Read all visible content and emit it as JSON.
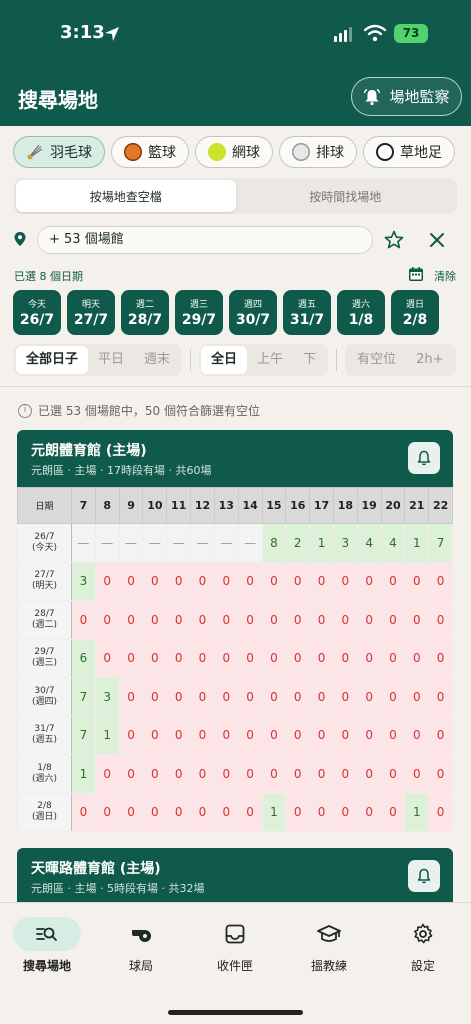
{
  "status": {
    "time": "3:13",
    "battery": "73"
  },
  "header": {
    "title": "搜尋場地",
    "monitor_label": "場地監察"
  },
  "sports": [
    {
      "label": "羽毛球",
      "icon": "shuttlecock-icon",
      "active": true
    },
    {
      "label": "籃球",
      "icon": "basketball-icon",
      "active": false
    },
    {
      "label": "網球",
      "icon": "tennis-ball-icon",
      "active": false
    },
    {
      "label": "排球",
      "icon": "volleyball-icon",
      "active": false
    },
    {
      "label": "草地足",
      "icon": "soccer-ball-icon",
      "active": false
    }
  ],
  "mode_tabs": [
    {
      "label": "按場地查空檔",
      "active": true
    },
    {
      "label": "按時間找場地",
      "active": false
    }
  ],
  "venue_filter": {
    "label": "+ 53 個場館"
  },
  "dates_section": {
    "selected_label": "已選 8 個日期",
    "clear_label": "清除"
  },
  "dates": [
    {
      "weekday": "今天",
      "date": "26/7"
    },
    {
      "weekday": "明天",
      "date": "27/7"
    },
    {
      "weekday": "週二",
      "date": "28/7"
    },
    {
      "weekday": "週三",
      "date": "29/7"
    },
    {
      "weekday": "週四",
      "date": "30/7"
    },
    {
      "weekday": "週五",
      "date": "31/7"
    },
    {
      "weekday": "週六",
      "date": "1/8"
    },
    {
      "weekday": "週日",
      "date": "2/8"
    }
  ],
  "filters": {
    "day_type": [
      "全部日子",
      "平日",
      "週末"
    ],
    "time_of_day": [
      "全日",
      "上午",
      "下"
    ],
    "availability": [
      "有空位",
      "2h+"
    ]
  },
  "info_text": "已選 53 個場館中，50 個符合篩選有空位",
  "venues": [
    {
      "name": "元朗體育館 (主場)",
      "meta": "元朗區 · 主場 · 17時段有場 · 共60場",
      "header_label": "日期",
      "hours": [
        "7",
        "8",
        "9",
        "10",
        "11",
        "12",
        "13",
        "14",
        "15",
        "16",
        "17",
        "18",
        "19",
        "20",
        "21",
        "22"
      ],
      "rows": [
        {
          "date": "26/7",
          "day": "(今天)",
          "cells": [
            "—",
            "—",
            "—",
            "—",
            "—",
            "—",
            "—",
            "—",
            "8",
            "2",
            "1",
            "3",
            "4",
            "4",
            "1",
            "7"
          ]
        },
        {
          "date": "27/7",
          "day": "(明天)",
          "cells": [
            "3",
            "0",
            "0",
            "0",
            "0",
            "0",
            "0",
            "0",
            "0",
            "0",
            "0",
            "0",
            "0",
            "0",
            "0",
            "0"
          ]
        },
        {
          "date": "28/7",
          "day": "(週二)",
          "cells": [
            "0",
            "0",
            "0",
            "0",
            "0",
            "0",
            "0",
            "0",
            "0",
            "0",
            "0",
            "0",
            "0",
            "0",
            "0",
            "0"
          ]
        },
        {
          "date": "29/7",
          "day": "(週三)",
          "cells": [
            "6",
            "0",
            "0",
            "0",
            "0",
            "0",
            "0",
            "0",
            "0",
            "0",
            "0",
            "0",
            "0",
            "0",
            "0",
            "0"
          ]
        },
        {
          "date": "30/7",
          "day": "(週四)",
          "cells": [
            "7",
            "3",
            "0",
            "0",
            "0",
            "0",
            "0",
            "0",
            "0",
            "0",
            "0",
            "0",
            "0",
            "0",
            "0",
            "0"
          ]
        },
        {
          "date": "31/7",
          "day": "(週五)",
          "cells": [
            "7",
            "1",
            "0",
            "0",
            "0",
            "0",
            "0",
            "0",
            "0",
            "0",
            "0",
            "0",
            "0",
            "0",
            "0",
            "0"
          ]
        },
        {
          "date": "1/8",
          "day": "(週六)",
          "cells": [
            "1",
            "0",
            "0",
            "0",
            "0",
            "0",
            "0",
            "0",
            "0",
            "0",
            "0",
            "0",
            "0",
            "0",
            "0",
            "0"
          ]
        },
        {
          "date": "2/8",
          "day": "(週日)",
          "cells": [
            "0",
            "0",
            "0",
            "0",
            "0",
            "0",
            "0",
            "0",
            "1",
            "0",
            "0",
            "0",
            "0",
            "0",
            "1",
            "0"
          ]
        }
      ]
    },
    {
      "name": "天暉路體育館 (主場)",
      "meta": "元朗區 · 主場 · 5時段有場 · 共32場"
    }
  ],
  "bottom_nav": [
    {
      "label": "搜尋場地",
      "icon": "search-list-icon",
      "active": true
    },
    {
      "label": "球局",
      "icon": "whistle-icon",
      "active": false
    },
    {
      "label": "收件匣",
      "icon": "inbox-icon",
      "active": false
    },
    {
      "label": "搵教練",
      "icon": "graduation-cap-icon",
      "active": false
    },
    {
      "label": "設定",
      "icon": "gear-icon",
      "active": false
    }
  ],
  "colors": {
    "brand": "#0f5a4a",
    "open": "#ddf1d9",
    "full": "#fde4e6",
    "full_text": "#d23535",
    "open_text": "#2e6e2c"
  }
}
